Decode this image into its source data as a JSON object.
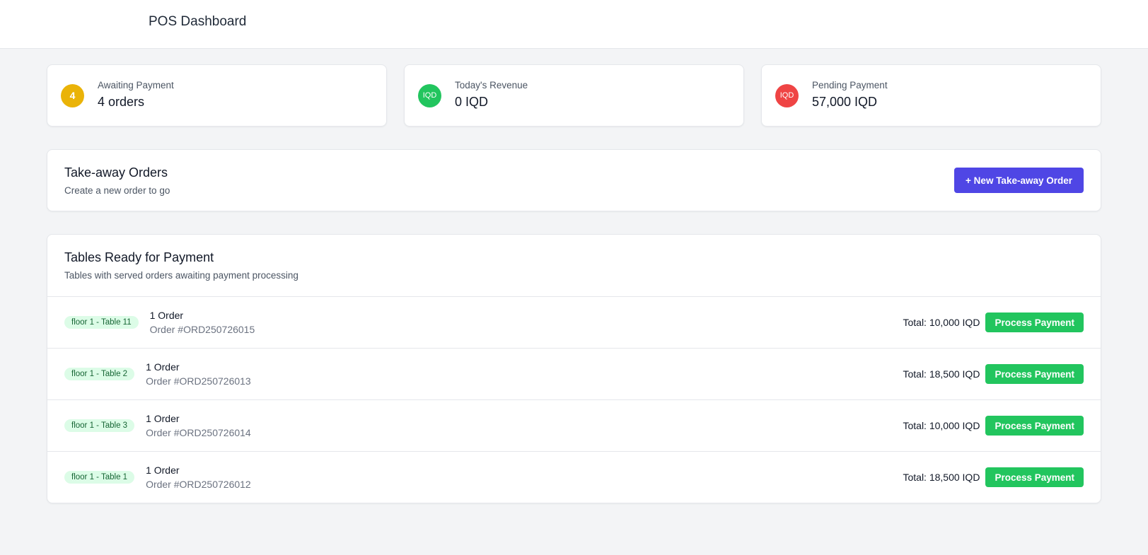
{
  "header": {
    "title": "POS Dashboard"
  },
  "stats": [
    {
      "icon_text": "4",
      "label": "Awaiting Payment",
      "value": "4 orders",
      "color": "#eab308"
    },
    {
      "icon_text": "IQD",
      "label": "Today's Revenue",
      "value": "0 IQD",
      "color": "#22c55e"
    },
    {
      "icon_text": "IQD",
      "label": "Pending Payment",
      "value": "57,000 IQD",
      "color": "#ef4444"
    }
  ],
  "takeaway": {
    "title": "Take-away Orders",
    "subtitle": "Create a new order to go",
    "button_label": "+ New Take-away Order"
  },
  "tables_panel": {
    "title": "Tables Ready for Payment",
    "subtitle": "Tables with served orders awaiting payment processing",
    "rows": [
      {
        "table": "floor 1 - Table 11",
        "count": "1 Order",
        "order_id": "Order #ORD250726015",
        "total": "Total: 10,000 IQD",
        "button": "Process Payment"
      },
      {
        "table": "floor 1 - Table 2",
        "count": "1 Order",
        "order_id": "Order #ORD250726013",
        "total": "Total: 18,500 IQD",
        "button": "Process Payment"
      },
      {
        "table": "floor 1 - Table 3",
        "count": "1 Order",
        "order_id": "Order #ORD250726014",
        "total": "Total: 10,000 IQD",
        "button": "Process Payment"
      },
      {
        "table": "floor 1 - Table 1",
        "count": "1 Order",
        "order_id": "Order #ORD250726012",
        "total": "Total: 18,500 IQD",
        "button": "Process Payment"
      }
    ]
  }
}
